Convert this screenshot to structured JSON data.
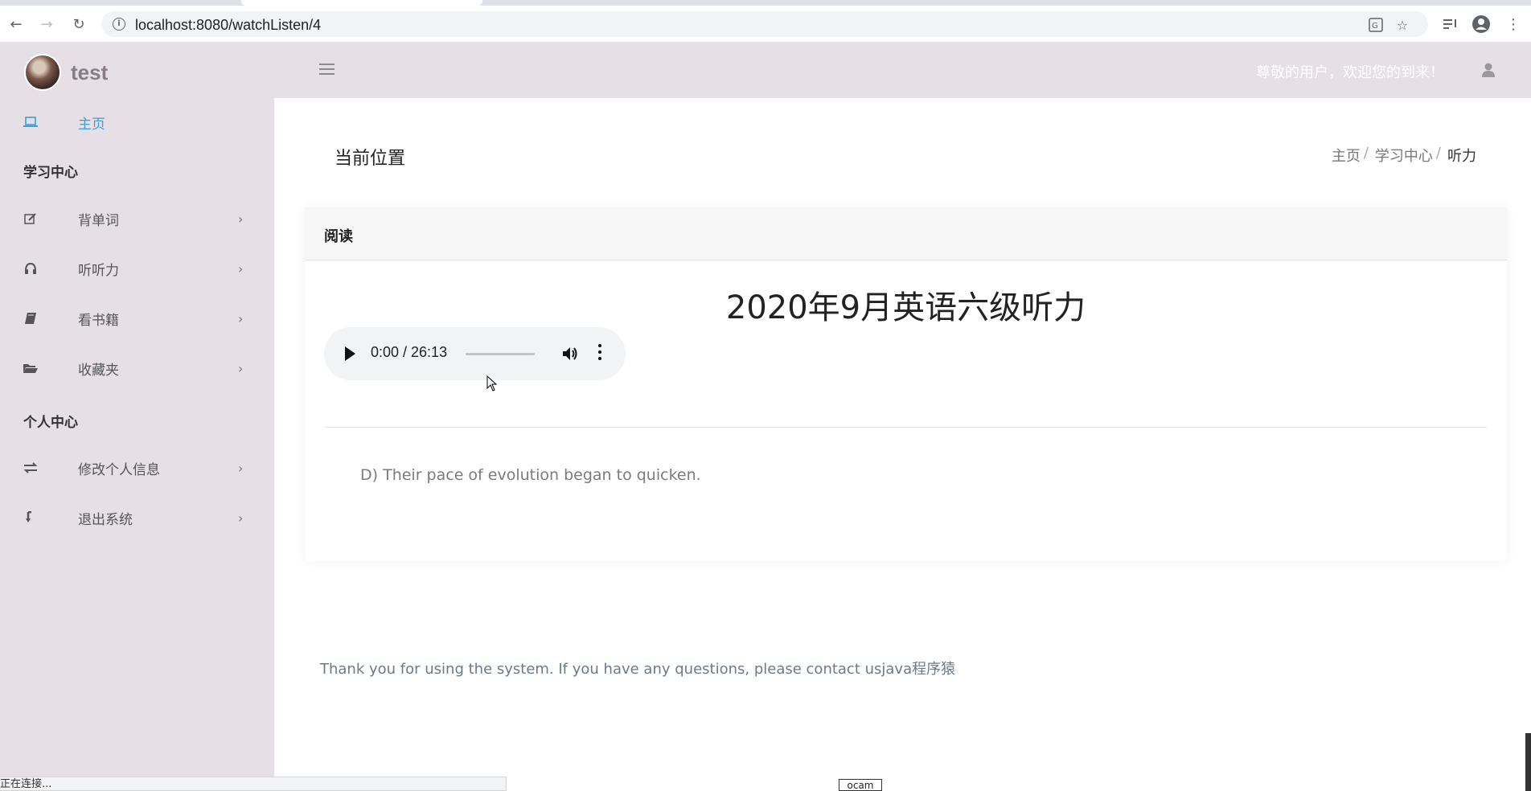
{
  "browser": {
    "url": "localhost:8080/watchListen/4"
  },
  "header": {
    "brand": "test",
    "welcome": "尊敬的用户，欢迎您的到来！"
  },
  "sidebar": {
    "home": "主页",
    "section_study": "学习中心",
    "study_items": [
      {
        "label": "背单词",
        "icon": "edit-icon"
      },
      {
        "label": "听听力",
        "icon": "headphones-icon"
      },
      {
        "label": "看书籍",
        "icon": "book-icon"
      },
      {
        "label": "收藏夹",
        "icon": "folder-icon"
      }
    ],
    "section_personal": "个人中心",
    "personal_items": [
      {
        "label": "修改个人信息",
        "icon": "exchange-icon"
      },
      {
        "label": "退出系统",
        "icon": "logout-icon"
      }
    ]
  },
  "main": {
    "page_title": "当前位置",
    "breadcrumb": [
      "主页",
      "学习中心",
      "听力"
    ],
    "card": {
      "header": "阅读",
      "title": "2020年9月英语六级听力",
      "audio": {
        "time": "0:00 / 26:13"
      },
      "option_text": "D) Their pace of evolution began to quicken."
    }
  },
  "footer": {
    "text": "Thank you for using the system. If you have any questions, please contact usjava程序猿"
  },
  "overlays": {
    "status_text": "正在连接...",
    "ocam_label": "ocam"
  },
  "colors": {
    "header_bg": "#e6dfe6",
    "sidebar_bg": "#e6dfe6",
    "active_link": "#3d9fd6"
  }
}
